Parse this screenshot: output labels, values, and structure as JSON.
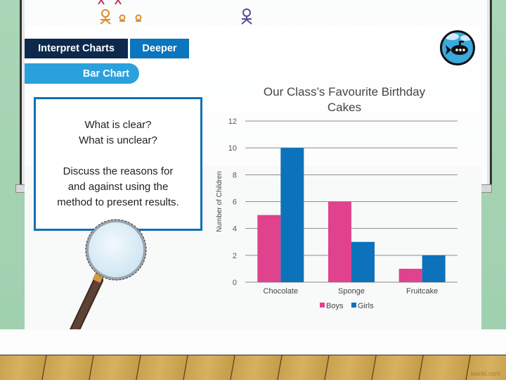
{
  "header": {
    "tab_interpret": "Interpret Charts",
    "tab_deeper": "Deeper",
    "tab_bar_chart": "Bar Chart"
  },
  "icons": {
    "badge": "submarine-icon",
    "tool": "magnifying-glass-icon"
  },
  "textbox": {
    "line1": "What is clear?",
    "line2": "What is unclear?",
    "line3": "Discuss the reasons for",
    "line4": "and against using the",
    "line5": "method to present results."
  },
  "colors": {
    "navy": "#0d2a4d",
    "blue": "#0b75bd",
    "light_blue": "#2aa1dc",
    "boys": "#e0428e",
    "girls": "#0b72bb"
  },
  "watermark": "twinkl.com",
  "chart_data": {
    "type": "bar",
    "title_line1": "Our Class’s Favourite Birthday",
    "title_line2": "Cakes",
    "xlabel": "",
    "ylabel": "Number of Children",
    "categories": [
      "Chocolate",
      "Sponge",
      "Fruitcake"
    ],
    "series": [
      {
        "name": "Boys",
        "color": "#e0428e",
        "values": [
          5,
          6,
          1
        ]
      },
      {
        "name": "Girls",
        "color": "#0b72bb",
        "values": [
          10,
          3,
          2
        ]
      }
    ],
    "ylim": [
      0,
      12
    ],
    "yticks": [
      0,
      2,
      4,
      6,
      8,
      10,
      12
    ],
    "grid": true,
    "legend": "bottom"
  }
}
